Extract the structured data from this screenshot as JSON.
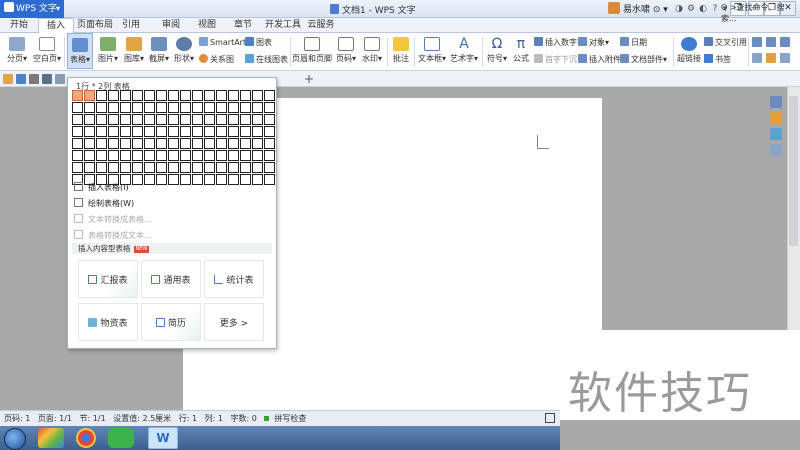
{
  "titlebar": {
    "app_name": "WPS 文字",
    "quick_dropdown": "▾",
    "doc_title": "文档1 - WPS 文字",
    "user_name": "易水啸",
    "user_status": "⊙ ▾",
    "window_controls": [
      "❐",
      "—",
      "❐",
      "✕"
    ]
  },
  "menu": {
    "tabs": [
      "开始",
      "插入",
      "页面布局",
      "引用",
      "审阅",
      "视图",
      "章节",
      "开发工具",
      "云服务"
    ],
    "active_tab": "插入"
  },
  "ribbon": {
    "pagebreak": "分页▾",
    "blankpage": "空白页▾",
    "table": "表格▾",
    "picture": "图片▾",
    "gallery": "图库▾",
    "screenshot": "截屏▾",
    "shapes": "形状▾",
    "smartart": "SmartArt",
    "chart": "图表",
    "relation": "关系图",
    "online_chart": "在线图表",
    "header_footer": "页眉和页脚",
    "page_number": "页码▾",
    "watermark": "水印▾",
    "comment": "批注",
    "textbox": "文本框▾",
    "wordart": "艺术字▾",
    "symbol": "符号▾",
    "formula": "公式",
    "insert_number": "插入数字",
    "object": "对象▾",
    "date": "日期",
    "first_char_sink": "首字下沉",
    "attach": "插入附件",
    "doc_part": "文档部件▾",
    "hyperlink": "超链接",
    "cross_ref": "交叉引用",
    "bookmark": "书签"
  },
  "qbar": {
    "add_tab": "+",
    "command_search": "Q >查找命令、搜索..."
  },
  "table_dropdown": {
    "grid_label": "1行 * 2列 表格",
    "rows": 8,
    "cols": 17,
    "selected_rows": 1,
    "selected_cols": 2,
    "menu_items": [
      {
        "label": "插入表格(I)",
        "enabled": true
      },
      {
        "label": "绘制表格(W)",
        "enabled": true
      },
      {
        "label": "文本转换成表格...",
        "enabled": false
      },
      {
        "label": "表格转换成文本...",
        "enabled": false
      }
    ],
    "section_title": "插入内容型表格",
    "new_badge": "NEW",
    "cards": [
      "汇报表",
      "通用表",
      "统计表",
      "物资表",
      "简历",
      "更多 >"
    ]
  },
  "watermark_text": "软件技巧",
  "statusbar": {
    "page": "页码: 1",
    "pages": "页面: 1/1",
    "section": "节: 1/1",
    "setting": "设置值: 2.5厘米",
    "row": "行: 1",
    "col": "列: 1",
    "chars": "字数: 0",
    "spell": "拼写检查"
  },
  "taskbar": {
    "wps_label": "W"
  },
  "colors": {
    "wps_blue": "#2d6bd2",
    "grid_selected": "#f2a77b",
    "new_badge": "#e24a3b"
  }
}
